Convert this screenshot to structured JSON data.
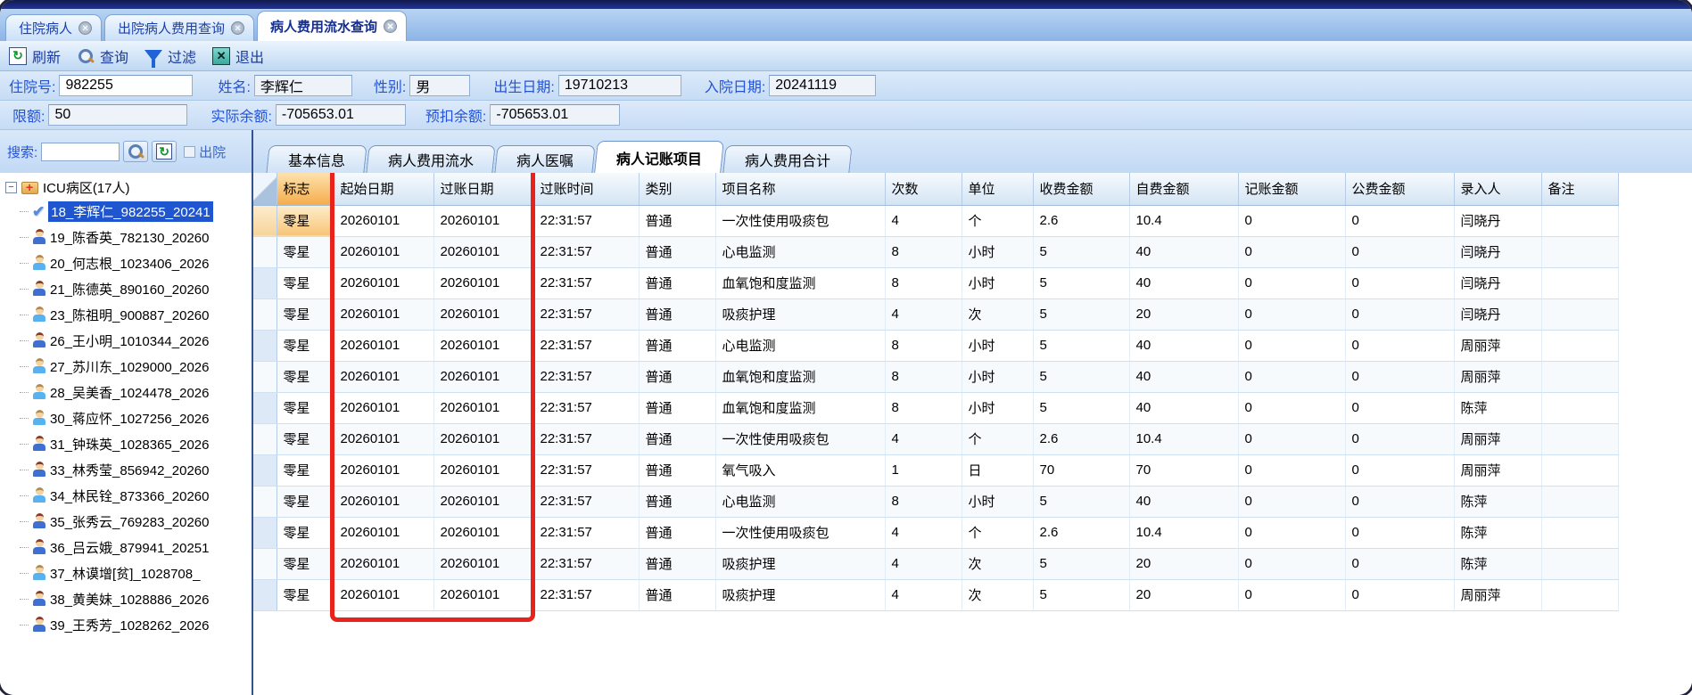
{
  "window": {
    "tabs": [
      {
        "label": "住院病人",
        "active": false
      },
      {
        "label": "出院病人费用查询",
        "active": false
      },
      {
        "label": "病人费用流水查询",
        "active": true
      }
    ]
  },
  "toolbar": {
    "refresh": "刷新",
    "query": "查询",
    "filter": "过滤",
    "exit": "退出"
  },
  "patient_info": {
    "row1": [
      {
        "label": "住院号:",
        "value": "982255"
      },
      {
        "label": "姓名:",
        "value": "李辉仁"
      },
      {
        "label": "性别:",
        "value": "男"
      },
      {
        "label": "出生日期:",
        "value": "19710213"
      },
      {
        "label": "入院日期:",
        "value": "20241119"
      }
    ],
    "row2": [
      {
        "label": "限额:",
        "value": "50"
      },
      {
        "label": "实际余额:",
        "value": "-705653.01"
      },
      {
        "label": "预扣余额:",
        "value": "-705653.01"
      }
    ]
  },
  "search": {
    "label": "搜索:",
    "value": "",
    "discharge_label": "出院",
    "discharge_checked": false
  },
  "sidebar": {
    "root": "ICU病区(17人)",
    "patients": [
      {
        "text": "18_李辉仁_982255_20241",
        "icon": "check",
        "selected": true
      },
      {
        "text": "19_陈香英_782130_20260",
        "icon": "female",
        "selected": false
      },
      {
        "text": "20_何志根_1023406_2026",
        "icon": "male",
        "selected": false
      },
      {
        "text": "21_陈德英_890160_20260",
        "icon": "female",
        "selected": false
      },
      {
        "text": "23_陈祖明_900887_20260",
        "icon": "male",
        "selected": false
      },
      {
        "text": "26_王小明_1010344_2026",
        "icon": "female",
        "selected": false
      },
      {
        "text": "27_苏川东_1029000_2026",
        "icon": "male",
        "selected": false
      },
      {
        "text": "28_吴美香_1024478_2026",
        "icon": "male",
        "selected": false
      },
      {
        "text": "30_蒋应怀_1027256_2026",
        "icon": "male",
        "selected": false
      },
      {
        "text": "31_钟珠英_1028365_2026",
        "icon": "female",
        "selected": false
      },
      {
        "text": "33_林秀莹_856942_20260",
        "icon": "female",
        "selected": false
      },
      {
        "text": "34_林民铨_873366_20260",
        "icon": "male",
        "selected": false
      },
      {
        "text": "35_张秀云_769283_20260",
        "icon": "female",
        "selected": false
      },
      {
        "text": "36_吕云娥_879941_20251",
        "icon": "female",
        "selected": false
      },
      {
        "text": "37_林谟增[贫]_1028708_",
        "icon": "male",
        "selected": false
      },
      {
        "text": "38_黄美妹_1028886_2026",
        "icon": "female",
        "selected": false
      },
      {
        "text": "39_王秀芳_1028262_2026",
        "icon": "female",
        "selected": false
      }
    ]
  },
  "content_tabs": {
    "items": [
      {
        "label": "基本信息",
        "active": false
      },
      {
        "label": "病人费用流水",
        "active": false
      },
      {
        "label": "病人医嘱",
        "active": false
      },
      {
        "label": "病人记账项目",
        "active": true
      },
      {
        "label": "病人费用合计",
        "active": false
      }
    ]
  },
  "grid": {
    "columns": [
      "标志",
      "起始日期",
      "过账日期",
      "过账时间",
      "类别",
      "项目名称",
      "次数",
      "单位",
      "收费金额",
      "自费金额",
      "记账金额",
      "公费金额",
      "录入人",
      "备注"
    ],
    "rows": [
      [
        "零星",
        "20260101",
        "20260101",
        "22:31:57",
        "普通",
        "一次性使用吸痰包",
        "4",
        "个",
        "2.6",
        "10.4",
        "0",
        "0",
        "闫晓丹",
        ""
      ],
      [
        "零星",
        "20260101",
        "20260101",
        "22:31:57",
        "普通",
        "心电监测",
        "8",
        "小时",
        "5",
        "40",
        "0",
        "0",
        "闫晓丹",
        ""
      ],
      [
        "零星",
        "20260101",
        "20260101",
        "22:31:57",
        "普通",
        "血氧饱和度监测",
        "8",
        "小时",
        "5",
        "40",
        "0",
        "0",
        "闫晓丹",
        ""
      ],
      [
        "零星",
        "20260101",
        "20260101",
        "22:31:57",
        "普通",
        "吸痰护理",
        "4",
        "次",
        "5",
        "20",
        "0",
        "0",
        "闫晓丹",
        ""
      ],
      [
        "零星",
        "20260101",
        "20260101",
        "22:31:57",
        "普通",
        "心电监测",
        "8",
        "小时",
        "5",
        "40",
        "0",
        "0",
        "周丽萍",
        ""
      ],
      [
        "零星",
        "20260101",
        "20260101",
        "22:31:57",
        "普通",
        "血氧饱和度监测",
        "8",
        "小时",
        "5",
        "40",
        "0",
        "0",
        "周丽萍",
        ""
      ],
      [
        "零星",
        "20260101",
        "20260101",
        "22:31:57",
        "普通",
        "血氧饱和度监测",
        "8",
        "小时",
        "5",
        "40",
        "0",
        "0",
        "陈萍",
        ""
      ],
      [
        "零星",
        "20260101",
        "20260101",
        "22:31:57",
        "普通",
        "一次性使用吸痰包",
        "4",
        "个",
        "2.6",
        "10.4",
        "0",
        "0",
        "周丽萍",
        ""
      ],
      [
        "零星",
        "20260101",
        "20260101",
        "22:31:57",
        "普通",
        "氧气吸入",
        "1",
        "日",
        "70",
        "70",
        "0",
        "0",
        "周丽萍",
        ""
      ],
      [
        "零星",
        "20260101",
        "20260101",
        "22:31:57",
        "普通",
        "心电监测",
        "8",
        "小时",
        "5",
        "40",
        "0",
        "0",
        "陈萍",
        ""
      ],
      [
        "零星",
        "20260101",
        "20260101",
        "22:31:57",
        "普通",
        "一次性使用吸痰包",
        "4",
        "个",
        "2.6",
        "10.4",
        "0",
        "0",
        "陈萍",
        ""
      ],
      [
        "零星",
        "20260101",
        "20260101",
        "22:31:57",
        "普通",
        "吸痰护理",
        "4",
        "次",
        "5",
        "20",
        "0",
        "0",
        "陈萍",
        ""
      ],
      [
        "零星",
        "20260101",
        "20260101",
        "22:31:57",
        "普通",
        "吸痰护理",
        "4",
        "次",
        "5",
        "20",
        "0",
        "0",
        "周丽萍",
        ""
      ]
    ]
  },
  "annotation": {
    "type": "red-highlight-box",
    "columns": "起始日期/过账日期",
    "color": "#e8231c"
  },
  "colors": {
    "header_orange": "#f5ad4b",
    "selection_blue": "#1f55cf",
    "chrome_navy": "#23339a"
  }
}
